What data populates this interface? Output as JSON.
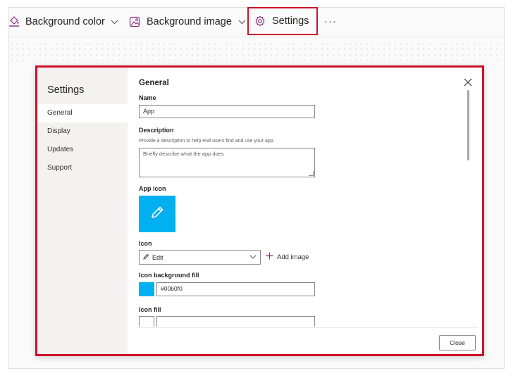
{
  "toolbar": {
    "background_color_label": "Background color",
    "background_image_label": "Background image",
    "settings_label": "Settings",
    "more_label": "···"
  },
  "dialog": {
    "nav_title": "Settings",
    "nav_items": [
      "General",
      "Display",
      "Updates",
      "Support"
    ],
    "active_nav": "General",
    "section_title": "General",
    "name": {
      "label": "Name",
      "value": "App"
    },
    "description": {
      "label": "Description",
      "help": "Provide a description to help end-users find and use your app.",
      "placeholder": "Briefly describe what the app does"
    },
    "app_icon": {
      "label": "App icon",
      "color": "#00b0f0"
    },
    "icon": {
      "label": "Icon",
      "selected": "Edit",
      "add_image_label": "Add image"
    },
    "icon_background_fill": {
      "label": "Icon background fill",
      "value": "#00b0f0"
    },
    "icon_fill": {
      "label": "Icon fill",
      "value": ""
    },
    "close_button_label": "Close"
  },
  "colors": {
    "highlight": "#d0102a",
    "accent": "#00b0f0",
    "brand_icon": "#8b2f86"
  }
}
